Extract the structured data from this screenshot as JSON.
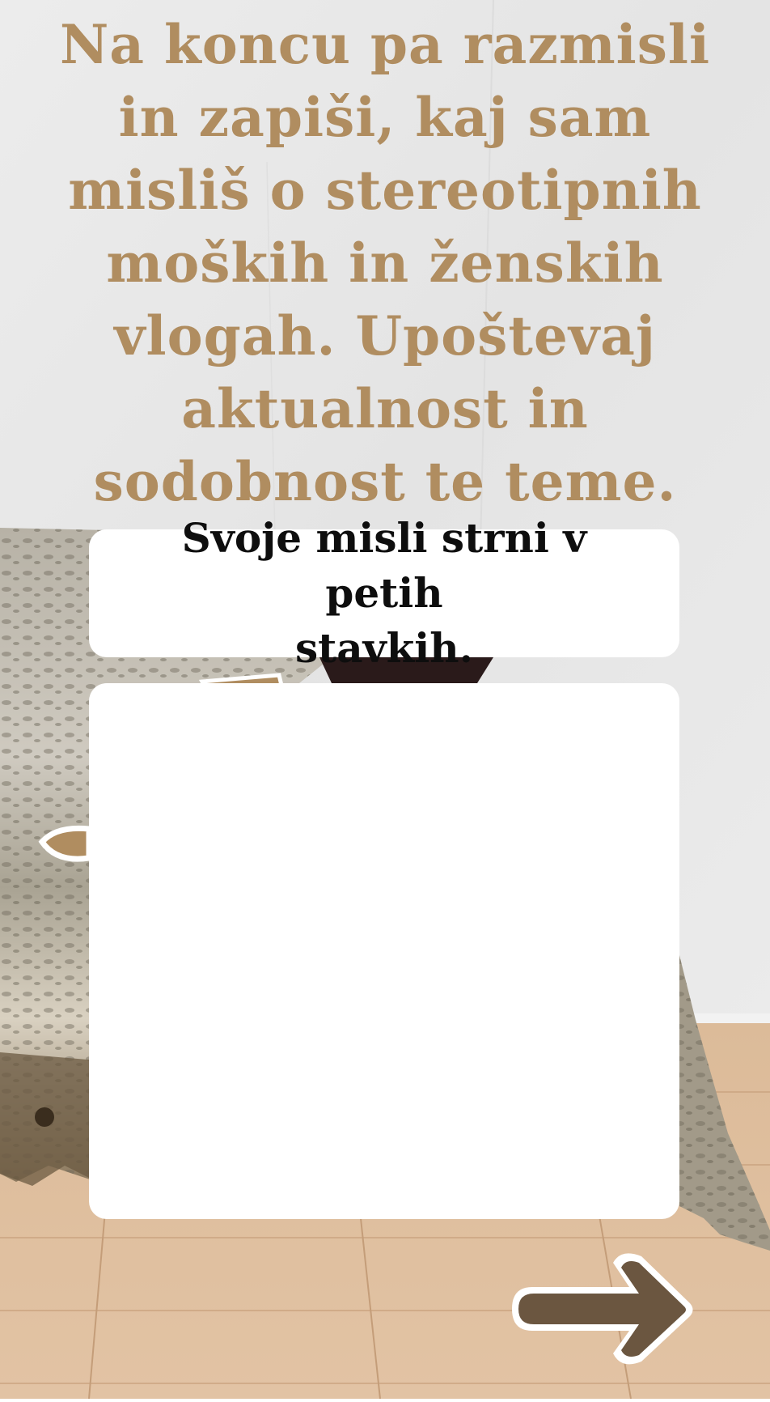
{
  "prompt": {
    "text": "Na koncu pa razmisli\nin zapiši, kaj sam\nmisliš o stereotipnih\nmoških in ženskih\nvlogah. Upoštevaj\naktualnost in\nsodobnost te teme."
  },
  "instruction": {
    "text": "Svoje misli strni v petih\nstavkih."
  },
  "answer": {
    "value": "",
    "placeholder": ""
  },
  "navigation": {
    "next_icon": "arrow-right-icon"
  },
  "colors": {
    "accent_text": "#b08d60",
    "arrow": "#6b5640",
    "wall": "#e7e7e7",
    "floor": "#d8b491"
  }
}
